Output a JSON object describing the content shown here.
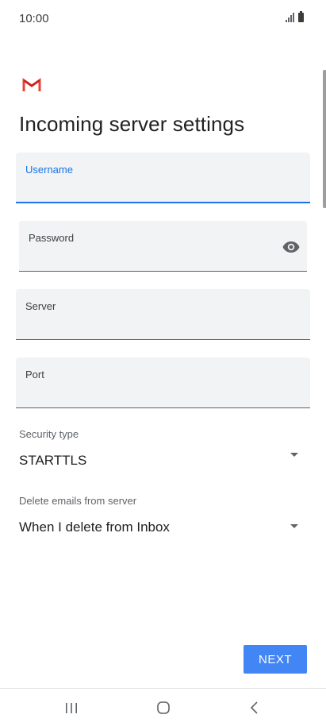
{
  "status_bar": {
    "time": "10:00"
  },
  "app": {
    "logo_icon": "gmail-logo-icon",
    "colors": {
      "accent": "#1a73e8",
      "button": "#4285f4",
      "field_bg": "#f1f3f4",
      "logo_red": "#ea4335"
    }
  },
  "page": {
    "title": "Incoming server settings"
  },
  "fields": {
    "username": {
      "label": "Username",
      "value": ""
    },
    "password": {
      "label": "Password",
      "value": "",
      "icon": "eye-icon"
    },
    "server": {
      "label": "Server",
      "value": ""
    },
    "port": {
      "label": "Port",
      "value": ""
    }
  },
  "dropdowns": {
    "security_type": {
      "label": "Security type",
      "value": "STARTTLS",
      "icon": "dropdown-arrow-icon"
    },
    "delete_emails": {
      "label": "Delete emails from server",
      "value": "When I delete from Inbox",
      "icon": "dropdown-arrow-icon"
    }
  },
  "actions": {
    "next_label": "NEXT"
  },
  "nav": {
    "recents_icon": "recents-icon",
    "home_icon": "home-icon",
    "back_icon": "back-icon"
  }
}
